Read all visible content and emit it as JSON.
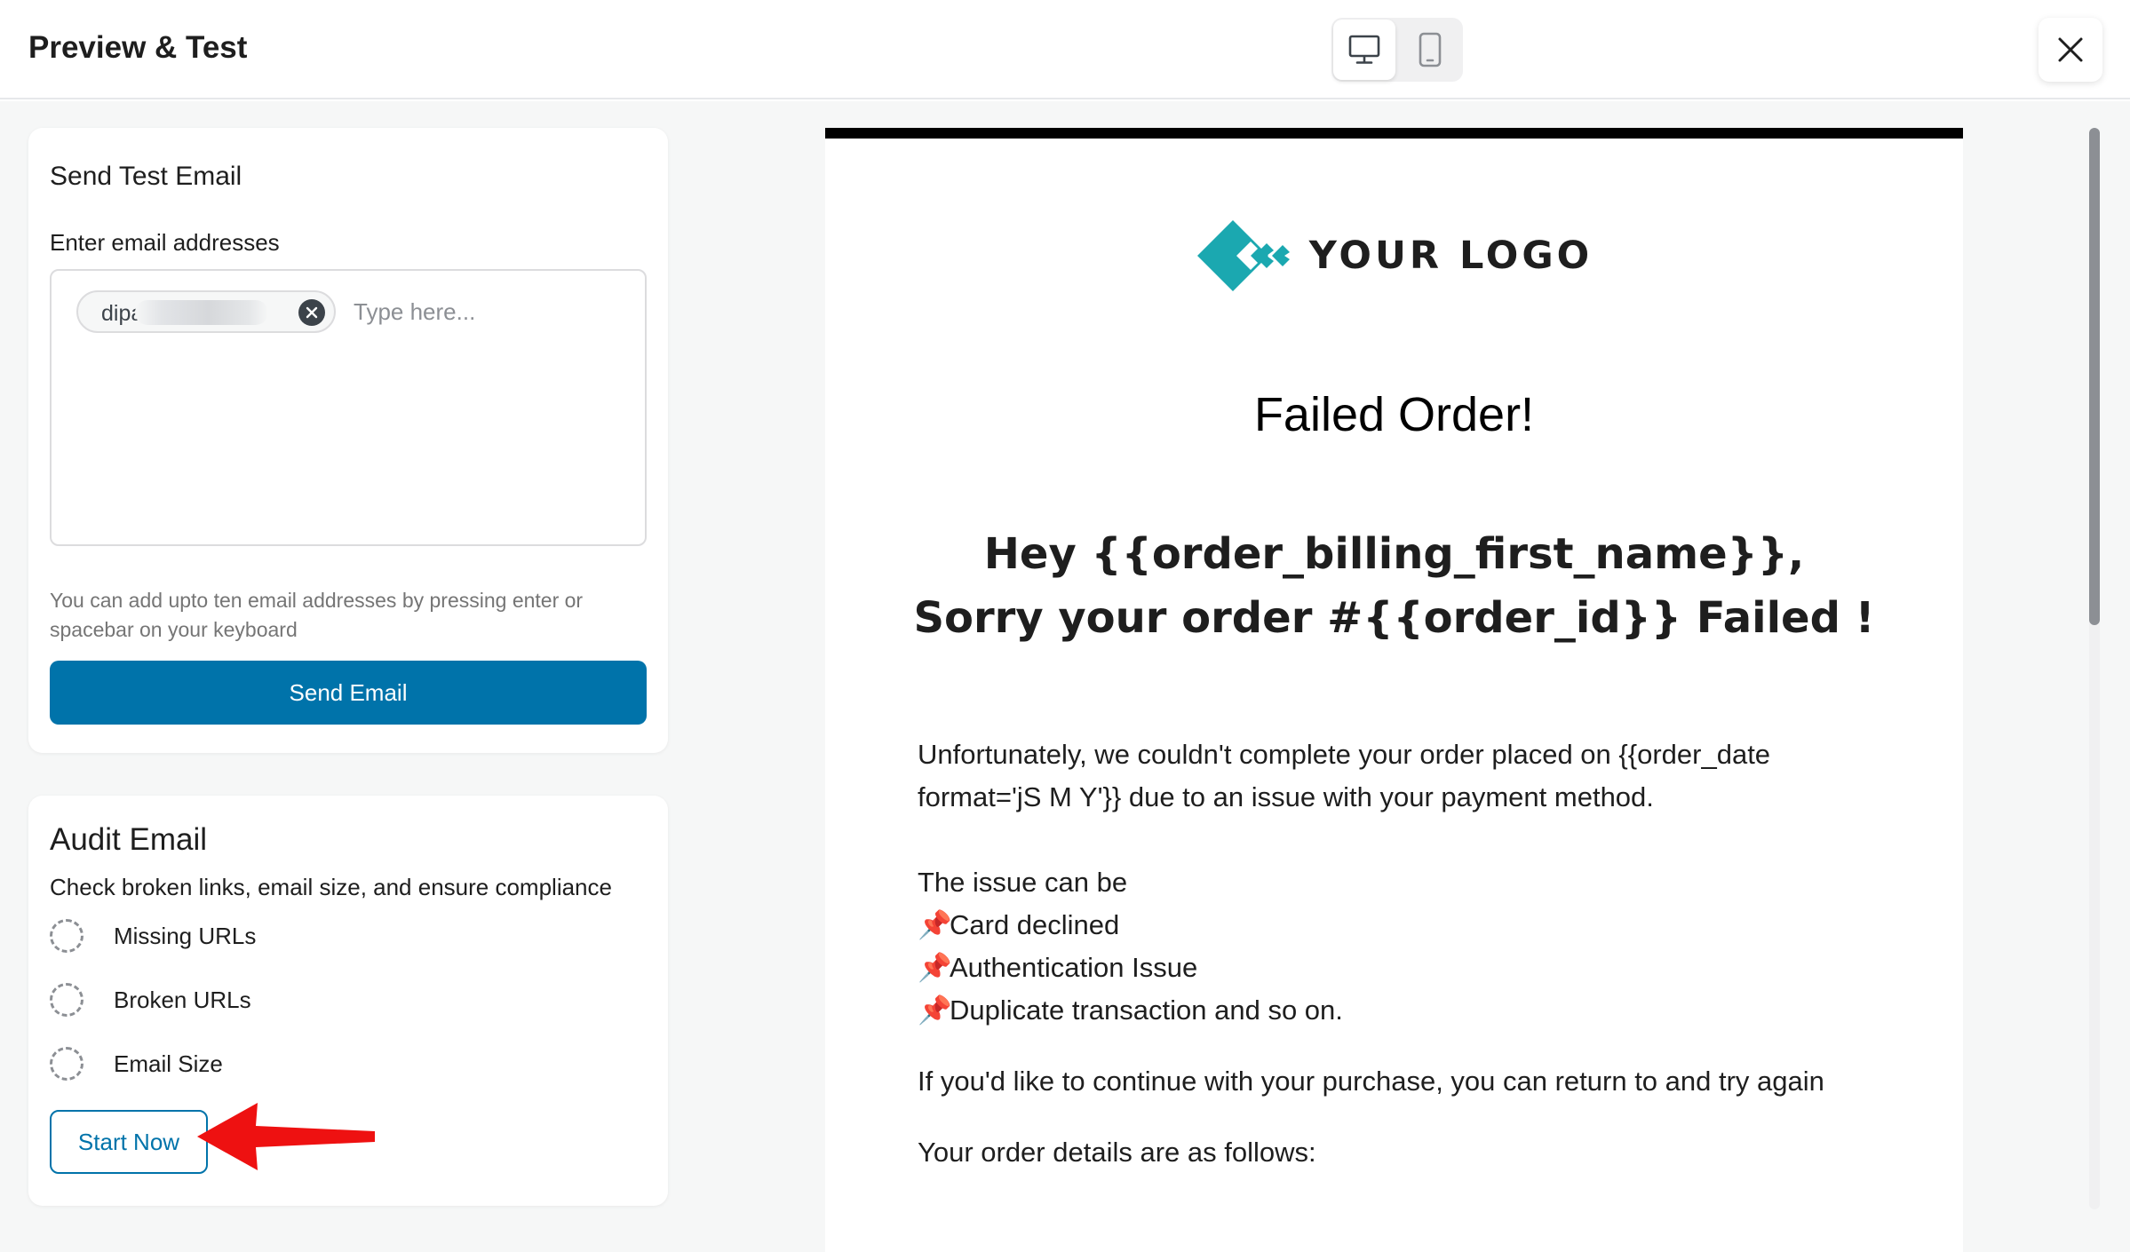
{
  "header": {
    "title": "Preview & Test"
  },
  "device_toggle": {
    "active": "desktop",
    "options": [
      "desktop-icon",
      "mobile-icon"
    ]
  },
  "send_test": {
    "title": "Send Test Email",
    "field_label": "Enter email addresses",
    "chip_text": "dipa",
    "input_placeholder": "Type here...",
    "help_text": "You can add upto ten email addresses by pressing enter or spacebar on your keyboard",
    "send_button": "Send Email"
  },
  "audit": {
    "title": "Audit Email",
    "subtitle": "Check broken links, email size, and ensure compliance",
    "checks": [
      "Missing URLs",
      "Broken URLs",
      "Email Size"
    ],
    "start_button": "Start Now"
  },
  "email_preview": {
    "logo_text": "YOUR LOGO",
    "heading": "Failed Order!",
    "greeting_line1": "Hey {{order_billing_first_name}},",
    "greeting_line2": "Sorry your order #{{order_id}} Failed !",
    "paragraph1_line1": "Unfortunately, we couldn't complete your order placed on {{order_date",
    "paragraph1_line2": "format='jS M Y'}} due to an issue with your payment method.",
    "issue_intro": "The issue can be",
    "issues": [
      "Card declined",
      "Authentication Issue",
      "Duplicate transaction and so on."
    ],
    "continue_text": "If you'd like to continue with your purchase, you can return to and try again",
    "details_text": "Your order details are as follows:"
  },
  "colors": {
    "primary": "#0073aa",
    "logo_teal": "#1ba8b0",
    "annotation_arrow": "#ee1111",
    "panel_bg": "#f6f7f7"
  }
}
